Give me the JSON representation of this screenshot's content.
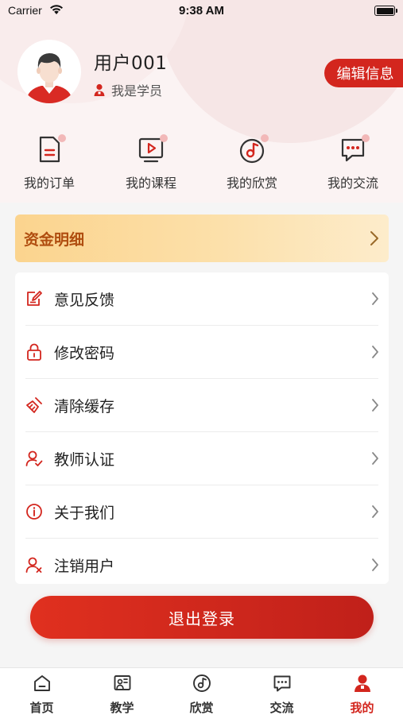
{
  "status_bar": {
    "carrier": "Carrier",
    "time": "9:38 AM"
  },
  "profile": {
    "username": "用户001",
    "role": "我是学员",
    "edit_label": "编辑信息"
  },
  "quick_entries": [
    {
      "label": "我的订单",
      "icon": "order-icon"
    },
    {
      "label": "我的课程",
      "icon": "course-icon"
    },
    {
      "label": "我的欣赏",
      "icon": "appreciation-icon"
    },
    {
      "label": "我的交流",
      "icon": "chat-icon"
    }
  ],
  "fund": {
    "label": "资金明细"
  },
  "menu": [
    {
      "label": "意见反馈",
      "icon": "feedback-icon"
    },
    {
      "label": "修改密码",
      "icon": "lock-icon"
    },
    {
      "label": "清除缓存",
      "icon": "broom-icon"
    },
    {
      "label": "教师认证",
      "icon": "teacher-verify-icon"
    },
    {
      "label": "关于我们",
      "icon": "info-icon"
    },
    {
      "label": "注销用户",
      "icon": "user-remove-icon"
    }
  ],
  "logout_label": "退出登录",
  "tabs": [
    {
      "label": "首页",
      "icon": "home-icon"
    },
    {
      "label": "教学",
      "icon": "teaching-icon"
    },
    {
      "label": "欣赏",
      "icon": "appreciation-icon"
    },
    {
      "label": "交流",
      "icon": "chat-icon"
    },
    {
      "label": "我的",
      "icon": "profile-icon",
      "active": true
    }
  ],
  "colors": {
    "accent": "#d3261e",
    "fund_text": "#b04e10",
    "fund_bg": "#fbd48e"
  }
}
